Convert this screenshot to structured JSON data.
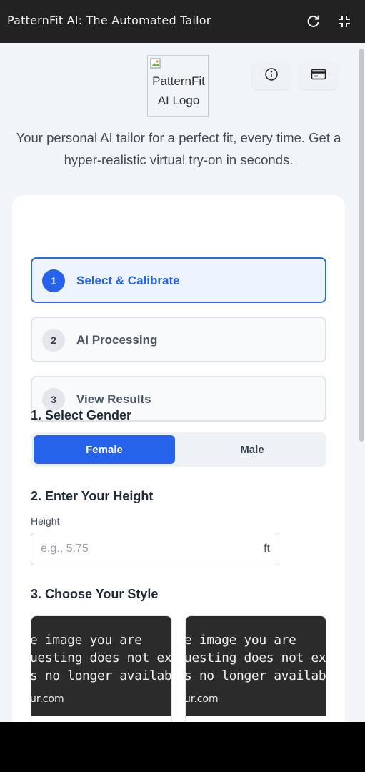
{
  "window": {
    "title": "PatternFit AI: The Automated Tailor"
  },
  "icons": {
    "reload": "reload-icon",
    "fullscreen": "exit-fullscreen-icon",
    "info": "info-icon",
    "card": "credit-card-icon"
  },
  "header": {
    "logo_alt": "PatternFit AI Logo",
    "tagline": "Your personal AI tailor for a perfect fit, every time. Get a hyper-realistic virtual try-on in seconds."
  },
  "steps": [
    {
      "num": "1",
      "label": "Select & Calibrate",
      "active": true
    },
    {
      "num": "2",
      "label": "AI Processing",
      "active": false
    },
    {
      "num": "3",
      "label": "View Results",
      "active": false
    }
  ],
  "gender": {
    "heading": "1. Select Gender",
    "options": [
      "Female",
      "Male"
    ],
    "selected": "Female"
  },
  "height": {
    "heading": "2. Enter Your Height",
    "label": "Height",
    "placeholder": "e.g., 5.75",
    "value": "",
    "unit": "ft"
  },
  "style": {
    "heading": "3. Choose Your Style",
    "cards": [
      {
        "lines": [
          "e image you are",
          "uesting does not ex",
          "s no longer availab"
        ],
        "site": "ur.com"
      },
      {
        "lines": [
          "e image you are",
          "uesting does not ex",
          "s no longer availab"
        ],
        "site": "ur.com"
      }
    ]
  },
  "colors": {
    "accent": "#2563eb",
    "titlebar": "#222222",
    "page_bg": "#f1f4f8"
  }
}
